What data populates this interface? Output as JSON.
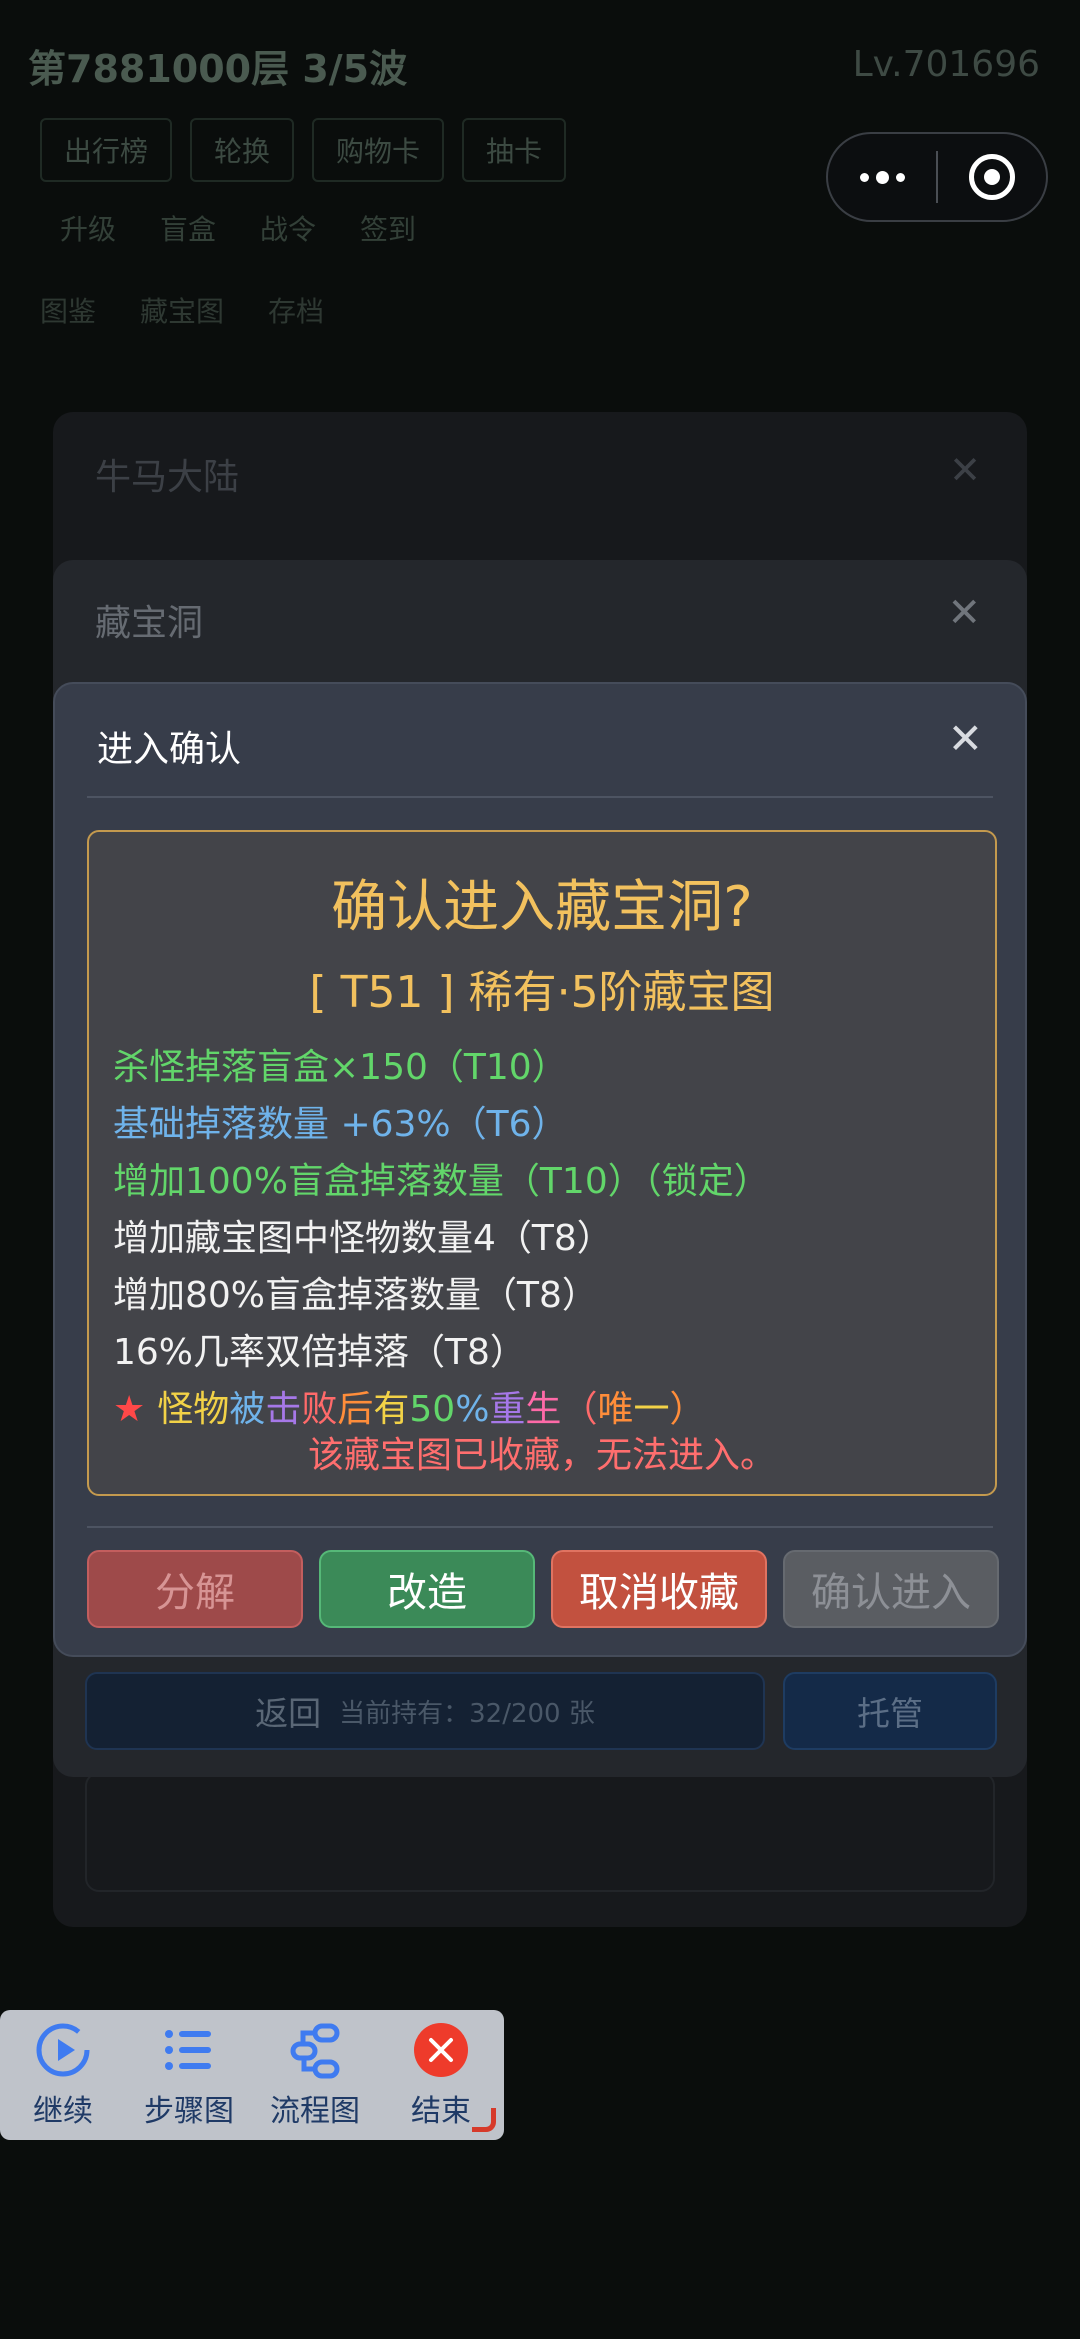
{
  "background": {
    "header_title": "第7881000层 3/5波",
    "header_level": "Lv.701696",
    "tabs": [
      "出行榜",
      "轮换",
      "购物卡",
      "抽卡"
    ],
    "row2": [
      "升级",
      "盲盒",
      "战令",
      "签到"
    ],
    "row3": [
      "图鉴",
      "藏宝图",
      "存档"
    ]
  },
  "capsule": {
    "more_icon": "more-dots-icon",
    "close_icon": "target-circle-icon"
  },
  "panel_outer": {
    "title": "牛马大陆"
  },
  "panel_middle": {
    "title": "藏宝洞",
    "return_label": "返回",
    "holding_text": "当前持有：32/200 张",
    "tuoguan_label": "托管"
  },
  "dialog": {
    "title": "进入确认",
    "question": "确认进入藏宝洞?",
    "map_name": "[ T51 ] 稀有·5阶藏宝图",
    "affixes": [
      {
        "text": "杀怪掉落盲盒×150（T10）",
        "color": "green"
      },
      {
        "text": "基础掉落数量 +63%（T6）",
        "color": "blue"
      },
      {
        "text": "增加100%盲盒掉落数量（T10）（锁定）",
        "color": "green"
      },
      {
        "text": "增加藏宝图中怪物数量4（T8）",
        "color": "white"
      },
      {
        "text": "增加80%盲盒掉落数量（T8）",
        "color": "white"
      },
      {
        "text": "16%几率双倍掉落（T8）",
        "color": "white"
      }
    ],
    "special_affix": {
      "star": "★",
      "segments": [
        {
          "text": "怪物",
          "color": "#f2d247"
        },
        {
          "text": "被",
          "color": "#6fb3ea"
        },
        {
          "text": "击",
          "color": "#a678e8"
        },
        {
          "text": "败",
          "color": "#ff6a6a"
        },
        {
          "text": "后",
          "color": "#ff8d3a"
        },
        {
          "text": "有",
          "color": "#f2d247"
        },
        {
          "text": "50",
          "color": "#62d66a"
        },
        {
          "text": "%",
          "color": "#6fb3ea"
        },
        {
          "text": "重",
          "color": "#a678e8"
        },
        {
          "text": "生",
          "color": "#ff6aa8"
        },
        {
          "text": "（",
          "color": "#ff6a6a"
        },
        {
          "text": "唯",
          "color": "#ff8d3a"
        },
        {
          "text": "一",
          "color": "#f2d247"
        },
        {
          "text": "）",
          "color": "#ff8d3a"
        }
      ]
    },
    "notice": "该藏宝图已收藏，无法进入。",
    "buttons": {
      "decompose": "分解",
      "reforge": "改造",
      "unfavorite": "取消收藏",
      "confirm_enter": "确认进入"
    }
  },
  "toolbar": {
    "items": [
      {
        "label": "继续",
        "icon": "play-icon"
      },
      {
        "label": "步骤图",
        "icon": "list-icon"
      },
      {
        "label": "流程图",
        "icon": "flowchart-icon"
      },
      {
        "label": "结束",
        "icon": "close-circle-icon"
      }
    ]
  },
  "colors": {
    "dialog_bg": "#373d4a",
    "gold": "#f2c15e",
    "green_affix": "#62d66a",
    "blue_affix": "#6fb3ea",
    "notice_red": "#ff6e6e"
  }
}
